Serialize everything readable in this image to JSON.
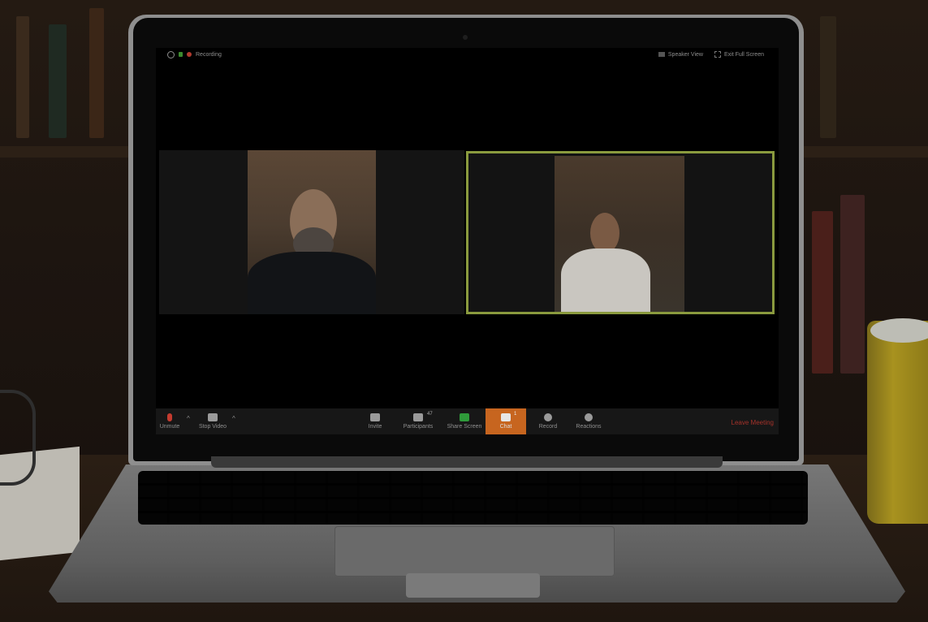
{
  "zoom": {
    "topbar": {
      "recording_label": "Recording",
      "speaker_view_label": "Speaker View",
      "exit_fullscreen_label": "Exit Full Screen"
    },
    "toolbar": {
      "unmute_label": "Unmute",
      "stop_video_label": "Stop Video",
      "invite_label": "Invite",
      "participants_label": "Participants",
      "participants_count": "47",
      "share_screen_label": "Share Screen",
      "chat_label": "Chat",
      "chat_count": "1",
      "record_label": "Record",
      "reactions_label": "Reactions",
      "leave_label": "Leave Meeting"
    },
    "colors": {
      "active_speaker_border": "#8a9a3e",
      "chat_highlight": "#c7651f",
      "leave_text": "#a5322a",
      "recording_dot": "#b03a2e"
    },
    "icons": [
      "info-icon",
      "lock-icon",
      "recording-dot-icon",
      "speaker-view-icon",
      "fullscreen-icon",
      "muted-mic-icon",
      "video-camera-icon",
      "invite-icon",
      "participants-icon",
      "share-screen-icon",
      "chat-icon",
      "record-icon",
      "reactions-icon",
      "chevron-up-icon"
    ]
  }
}
